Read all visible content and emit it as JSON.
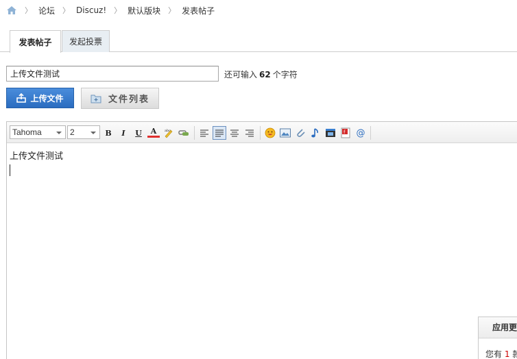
{
  "breadcrumb": {
    "items": [
      "论坛",
      "Discuz!",
      "默认版块",
      "发表帖子"
    ],
    "separator": "〉"
  },
  "tabs": [
    {
      "label": "发表帖子",
      "active": true
    },
    {
      "label": "发起投票",
      "active": false
    }
  ],
  "subject": {
    "value": "上传文件测试",
    "hint_prefix": "还可输入",
    "hint_count": "62",
    "hint_suffix": "个字符"
  },
  "buttons": {
    "upload_label": "上传文件",
    "file_list_label": "文件列表"
  },
  "toolbar": {
    "font_family": "Tahoma",
    "font_size": "2",
    "bold": "B",
    "italic": "I",
    "underline": "U",
    "font_color": "A",
    "at": "@"
  },
  "editor": {
    "content": "上传文件测试"
  },
  "notice": {
    "title": "应用更",
    "body_prefix": "您有",
    "body_count": "1",
    "body_suffix": "款"
  },
  "colors": {
    "upload_button": "#2f74c9",
    "tab_inactive_bg": "#e8eef3",
    "notice_count": "#cc0000"
  }
}
